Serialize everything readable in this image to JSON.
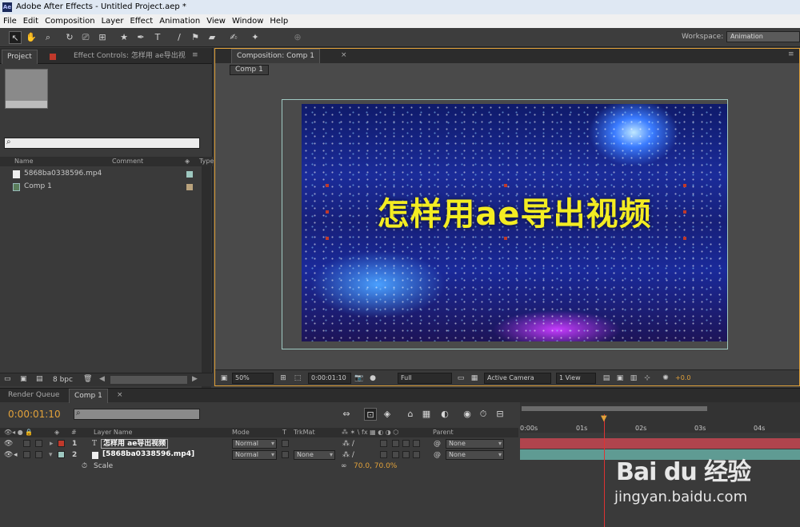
{
  "window": {
    "title": "Adobe After Effects - Untitled Project.aep *",
    "app_icon": "Ae"
  },
  "menu": [
    "File",
    "Edit",
    "Composition",
    "Layer",
    "Effect",
    "Animation",
    "View",
    "Window",
    "Help"
  ],
  "toolbar": {
    "workspace_label": "Workspace:",
    "workspace_value": "Animation"
  },
  "project": {
    "tab_project": "Project",
    "tab_effect_controls": "Effect Controls: 怎样用 ae导出视",
    "menu_glyph": "≡",
    "columns": {
      "name": "Name",
      "comment": "Comment",
      "type": "Type"
    },
    "items": [
      {
        "name": "5868ba0338596.mp4",
        "kind": "video",
        "color": "#9ec8c0"
      },
      {
        "name": "Comp 1",
        "kind": "comp",
        "color": "#b9a27c"
      }
    ],
    "bpc": "8 bpc"
  },
  "comp": {
    "tab": "Composition: Comp 1",
    "sub_tab": "Comp 1",
    "title_text": "怎样用ae导出视频",
    "footer": {
      "zoom": "50%",
      "timecode": "0:00:01:10",
      "resolution": "Full",
      "camera": "Active Camera",
      "views": "1 View",
      "exposure": "+0.0"
    }
  },
  "timeline": {
    "tab_render": "Render Queue",
    "tab_comp": "Comp 1",
    "timecode": "0:00:01:10",
    "columns": {
      "layer_name": "Layer Name",
      "mode": "Mode",
      "t": "T",
      "trkmat": "TrkMat",
      "parent": "Parent",
      "num": "#"
    },
    "layers": [
      {
        "num": "1",
        "name": "怎样用 ae导出视频",
        "mode": "Normal",
        "trkmat": "",
        "parent": "None",
        "color": "#c0392b",
        "type_icon": "T"
      },
      {
        "num": "2",
        "name": "[5868ba0338596.mp4]",
        "mode": "Normal",
        "trkmat": "None",
        "parent": "None",
        "color": "#9ec8c0",
        "type_icon": "file"
      }
    ],
    "property": {
      "name": "Scale",
      "value": "70.0, 70.0%"
    },
    "ruler": [
      "0:00s",
      "01s",
      "02s",
      "03s",
      "04s"
    ]
  },
  "watermark": {
    "brand": "Bai du 经验",
    "url": "jingyan.baidu.com"
  }
}
